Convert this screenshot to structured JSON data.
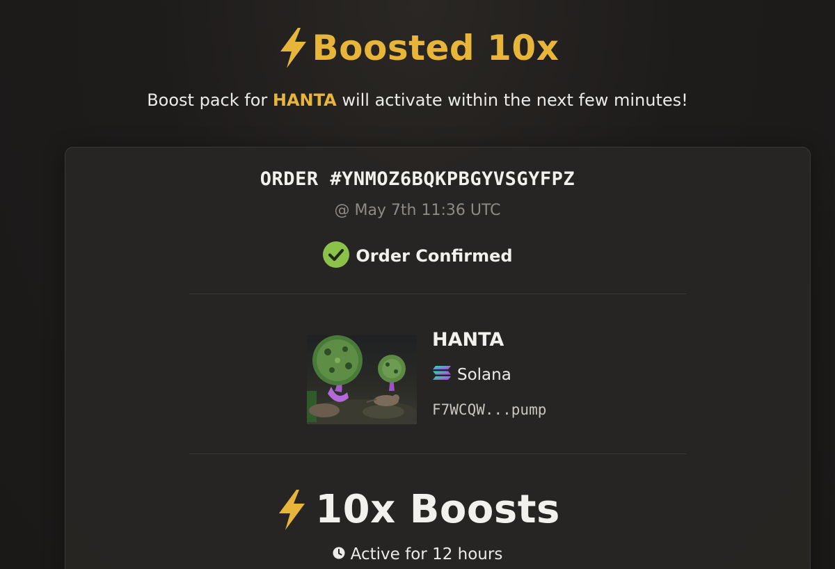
{
  "hero": {
    "title": "Boosted 10x",
    "subtitle_before": "Boost pack for ",
    "subtitle_token": "HANTA",
    "subtitle_after": " will activate within the next few minutes!"
  },
  "order": {
    "id": "ORDER #YNMOZ6BQKPBGYVSGYFPZ",
    "time": "@ May 7th 11:36 UTC",
    "status": "Order Confirmed"
  },
  "token": {
    "name": "HANTA",
    "chain": "Solana",
    "address": "F7WCQW...pump"
  },
  "boost": {
    "title": "10x Boosts",
    "duration": "Active for 12 hours"
  },
  "colors": {
    "accent": "#e8b53b",
    "success": "#8bc34a",
    "background": "#1e1c1b",
    "card": "#282624"
  },
  "icons": {
    "bolt": "lightning-bolt-icon",
    "confirmed": "check-circle-icon",
    "chain": "solana-logo-icon",
    "clock": "clock-icon"
  }
}
